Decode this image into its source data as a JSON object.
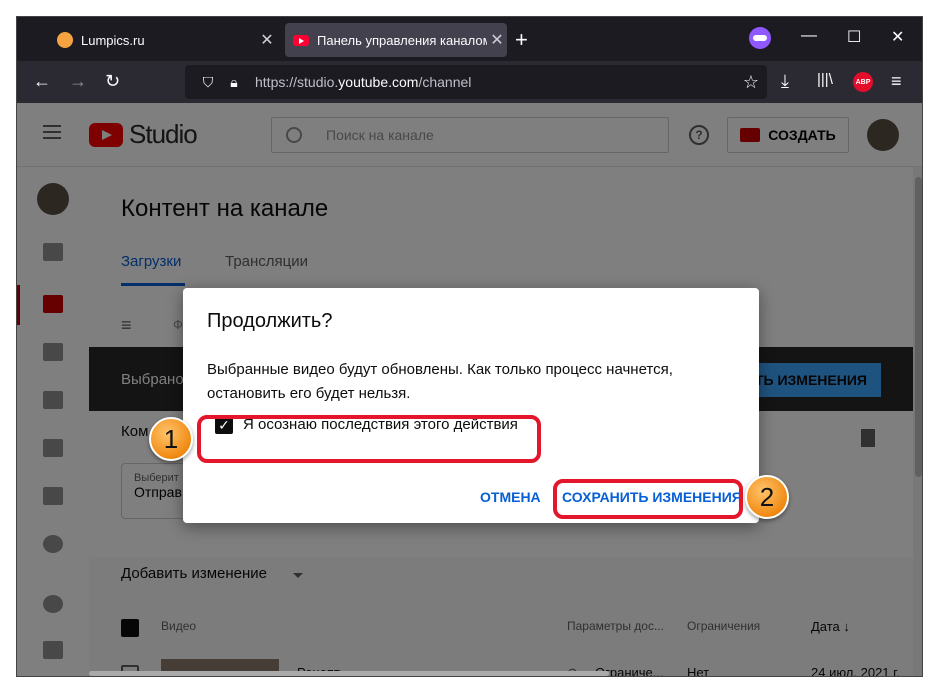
{
  "browser": {
    "tabs": [
      {
        "label": "Lumpics.ru"
      },
      {
        "label": "Панель управления каналом"
      }
    ],
    "new_tab": "+",
    "url_prefix": "https://studio.",
    "url_domain": "youtube.com",
    "url_path": "/channel",
    "abp": "ABP"
  },
  "studio": {
    "logo_text": "Studio",
    "search_placeholder": "Поиск на канале",
    "help": "?",
    "create_label": "СОЗДАТЬ",
    "page_title": "Контент на канале",
    "tabs": [
      {
        "label": "Загрузки"
      },
      {
        "label": "Трансляции"
      }
    ],
    "filter_hint": "Ф",
    "dark_bar_text": "Выбрано",
    "dark_bar_button": "ТЬ ИЗМЕНЕНИЯ",
    "comment_label": "Ком",
    "select_small": "Выберит",
    "select_value": "Отправ",
    "add_change": "Добавить изменение",
    "columns": [
      "Видео",
      "Параметры дос...",
      "Ограничения",
      "Дата ↓"
    ],
    "row": {
      "title": "Рецепт",
      "visibility": "Ограниче...",
      "restrictions": "Нет",
      "date": "24 июл. 2021 г."
    }
  },
  "dialog": {
    "title": "Продолжить?",
    "body": "Выбранные видео будут обновлены. Как только процесс начнется, остановить его будет нельзя.",
    "checkbox_label": "Я осознаю последствия этого действия",
    "checkbox_mark": "✓",
    "cancel": "ОТМЕНА",
    "save": "СОХРАНИТЬ ИЗМЕНЕНИЯ"
  },
  "annotations": {
    "badge1": "1",
    "badge2": "2",
    "highlight_color": "#e4162b",
    "badge_color": "#f08a12"
  }
}
